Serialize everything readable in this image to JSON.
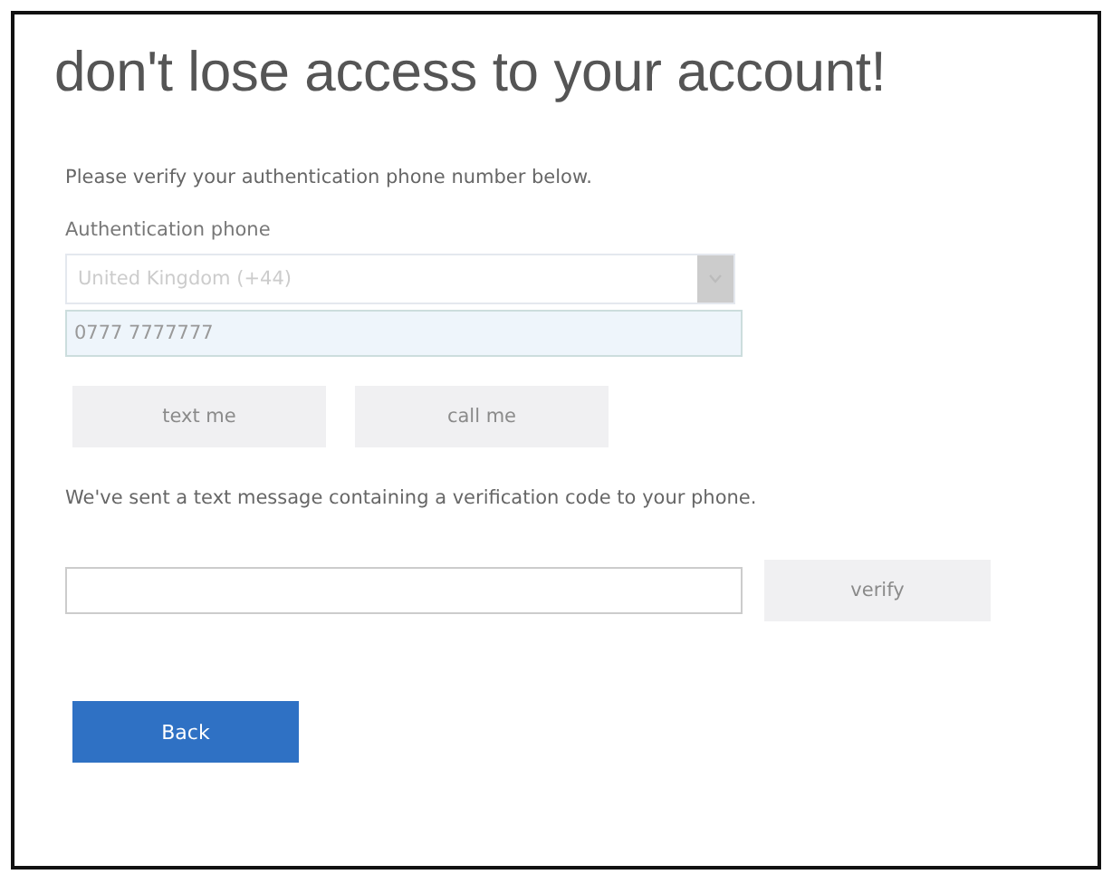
{
  "title": "don't lose access to your account!",
  "intro": "Please verify your authentication phone number below.",
  "phone": {
    "label": "Authentication phone",
    "country": "United Kingdom (+44)",
    "country_disabled": true,
    "number": "0777 7777777",
    "number_disabled": true
  },
  "send_buttons": [
    {
      "label": "text me",
      "disabled": true
    },
    {
      "label": "call me",
      "disabled": true
    }
  ],
  "message": "We've sent a text message containing a verification code to your phone.",
  "verify": {
    "label": "verify",
    "disabled": true
  },
  "back": {
    "label": "Back"
  }
}
